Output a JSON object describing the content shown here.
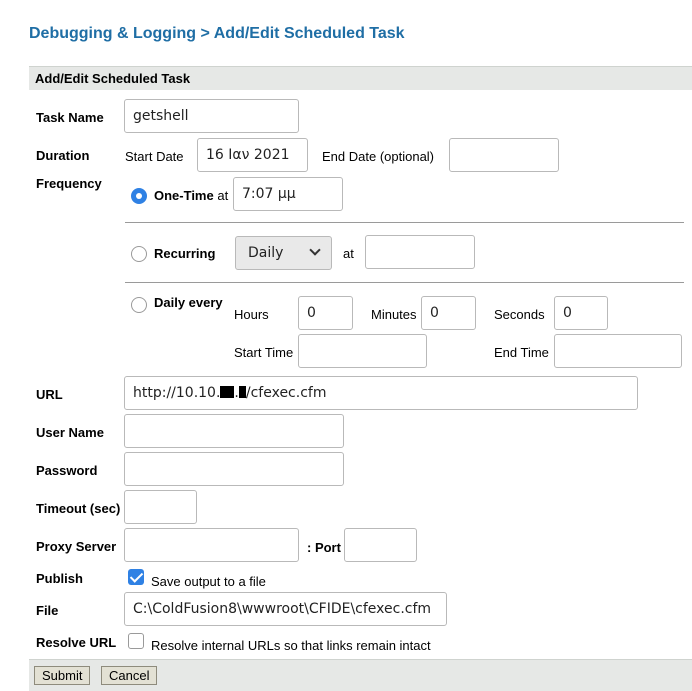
{
  "breadcrumb": {
    "parent": "Debugging & Logging",
    "separator": ">",
    "current": "Add/Edit Scheduled Task"
  },
  "section_title": "Add/Edit Scheduled Task",
  "fields": {
    "task_name": {
      "label": "Task Name",
      "value": "getshell"
    },
    "duration": {
      "label": "Duration",
      "start_label": "Start Date",
      "start_value": "16 Ιαν 2021",
      "end_label": "End Date (optional)",
      "end_value": ""
    },
    "frequency": {
      "label": "Frequency",
      "selected": "one-time",
      "one_time": {
        "label": "One-Time",
        "at_label": "at",
        "time": "7:07 μμ"
      },
      "recurring": {
        "label": "Recurring",
        "select_value": "Daily",
        "at_label": "at",
        "time": ""
      },
      "daily_every": {
        "label": "Daily every",
        "hours_label": "Hours",
        "hours": "0",
        "minutes_label": "Minutes",
        "minutes": "0",
        "seconds_label": "Seconds",
        "seconds": "0",
        "start_time_label": "Start Time",
        "start_time": "",
        "end_time_label": "End Time",
        "end_time": ""
      }
    },
    "url": {
      "label": "URL",
      "prefix": "http://10.10.",
      "dot": ".",
      "suffix": "/cfexec.cfm"
    },
    "username": {
      "label": "User Name",
      "value": ""
    },
    "password": {
      "label": "Password",
      "value": ""
    },
    "timeout": {
      "label": "Timeout (sec)",
      "value": ""
    },
    "proxy": {
      "label": "Proxy Server",
      "value": "",
      "port_label": ": Port",
      "port_value": ""
    },
    "publish": {
      "label": "Publish",
      "checked": true,
      "checkbox_label": "Save output to a file"
    },
    "file": {
      "label": "File",
      "value": "C:\\ColdFusion8\\wwwroot\\CFIDE\\cfexec.cfm"
    },
    "resolve_url": {
      "label": "Resolve URL",
      "checked": false,
      "checkbox_label": "Resolve internal URLs so that links remain intact"
    }
  },
  "buttons": {
    "submit": "Submit",
    "cancel": "Cancel"
  },
  "colors": {
    "link": "#1f6ea5",
    "header_bg": "#e6e8e6",
    "accent": "#2f81e4"
  }
}
